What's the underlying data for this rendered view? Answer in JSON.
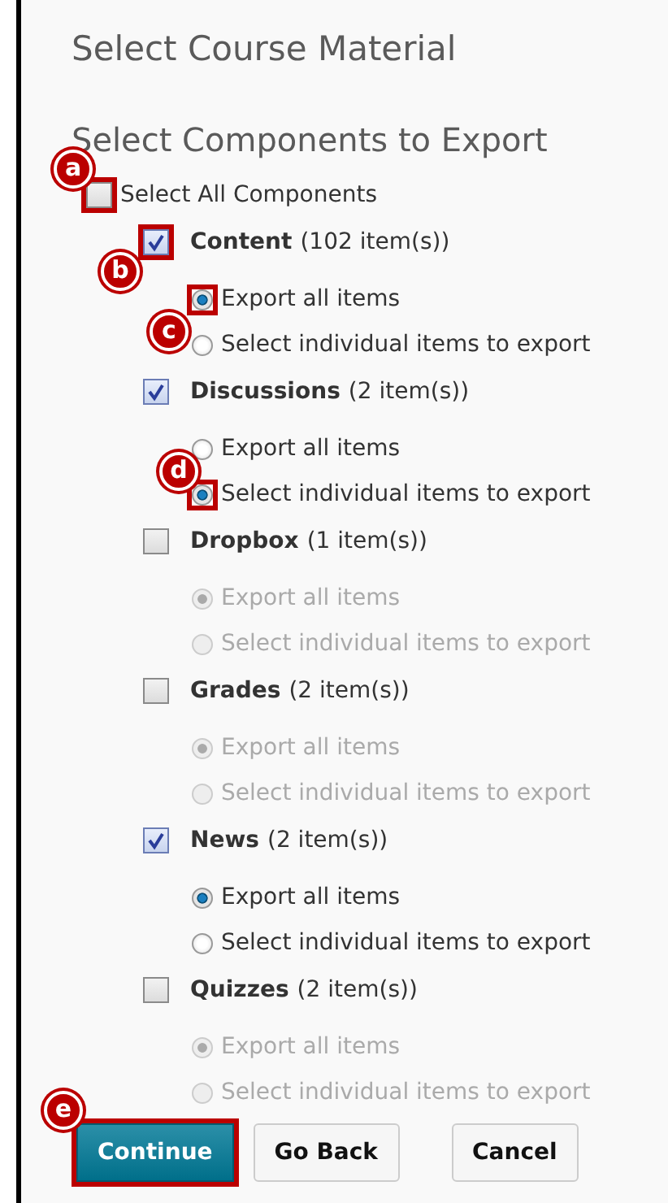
{
  "title": "Select Course Material",
  "subtitle": "Select Components to Export",
  "select_all": {
    "label": "Select All Components",
    "checked": false,
    "callout": {
      "letter": "a"
    }
  },
  "components": [
    {
      "name": "Content",
      "count": "(102 item(s))",
      "checked": true,
      "callout": {
        "letter": "b"
      },
      "options": [
        {
          "label": "Export all items",
          "selected": true,
          "disabled": false,
          "callout": {
            "letter": "c"
          }
        },
        {
          "label": "Select individual items to export",
          "selected": false,
          "disabled": false
        }
      ]
    },
    {
      "name": "Discussions",
      "count": "(2 item(s))",
      "checked": true,
      "options": [
        {
          "label": "Export all items",
          "selected": false,
          "disabled": false
        },
        {
          "label": "Select individual items to export",
          "selected": true,
          "disabled": false,
          "callout": {
            "letter": "d"
          }
        }
      ]
    },
    {
      "name": "Dropbox",
      "count": "(1 item(s))",
      "checked": false,
      "options": [
        {
          "label": "Export all items",
          "selected": true,
          "disabled": true
        },
        {
          "label": "Select individual items to export",
          "selected": false,
          "disabled": true
        }
      ]
    },
    {
      "name": "Grades",
      "count": "(2 item(s))",
      "checked": false,
      "options": [
        {
          "label": "Export all items",
          "selected": true,
          "disabled": true
        },
        {
          "label": "Select individual items to export",
          "selected": false,
          "disabled": true
        }
      ]
    },
    {
      "name": "News",
      "count": "(2 item(s))",
      "checked": true,
      "options": [
        {
          "label": "Export all items",
          "selected": true,
          "disabled": false
        },
        {
          "label": "Select individual items to export",
          "selected": false,
          "disabled": false
        }
      ]
    },
    {
      "name": "Quizzes",
      "count": "(2 item(s))",
      "checked": false,
      "options": [
        {
          "label": "Export all items",
          "selected": true,
          "disabled": true
        },
        {
          "label": "Select individual items to export",
          "selected": false,
          "disabled": true
        }
      ]
    }
  ],
  "buttons": [
    {
      "label": "Continue",
      "kind": "primary",
      "callout": {
        "letter": "e"
      }
    },
    {
      "label": "Go Back",
      "kind": "secondary"
    },
    {
      "label": "Cancel",
      "kind": "secondary"
    }
  ]
}
